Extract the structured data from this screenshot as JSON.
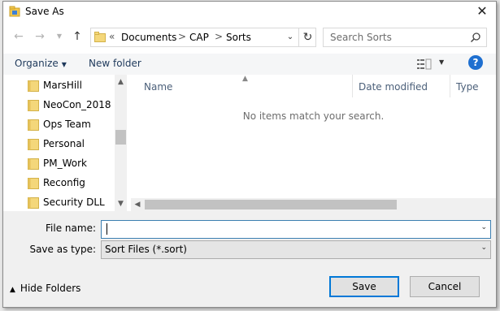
{
  "window": {
    "title": "Save As"
  },
  "address": {
    "overflow": "«",
    "crumbs": [
      "Documents",
      "CAP",
      "Sorts"
    ],
    "separator": ">"
  },
  "search": {
    "placeholder": "Search Sorts"
  },
  "toolbar": {
    "organize_label": "Organize",
    "new_folder_label": "New folder",
    "help_label": "?"
  },
  "navpane": {
    "items": [
      {
        "label": "MarsHill"
      },
      {
        "label": "NeoCon_2018"
      },
      {
        "label": "Ops Team"
      },
      {
        "label": "Personal"
      },
      {
        "label": "PM_Work"
      },
      {
        "label": "Reconfig"
      },
      {
        "label": "Security DLL"
      }
    ]
  },
  "filelist": {
    "columns": [
      "Name",
      "Date modified",
      "Type"
    ],
    "empty_message": "No items match your search."
  },
  "form": {
    "filename_label": "File name:",
    "filename_value": "",
    "savetype_label": "Save as type:",
    "savetype_value": "Sort Files (*.sort)"
  },
  "footer": {
    "hide_folders_label": "Hide Folders",
    "save_label": "Save",
    "cancel_label": "Cancel"
  },
  "colors": {
    "accent": "#0078d7",
    "folder": "#f4d77a",
    "link_text": "#1e395b"
  },
  "icons": {
    "app": "save-as-app-icon",
    "back": "back-arrow-icon",
    "forward": "forward-arrow-icon",
    "recent": "recent-locations-icon",
    "up": "up-arrow-icon",
    "refresh": "refresh-icon",
    "search": "search-icon",
    "view": "view-options-icon",
    "help": "help-icon",
    "close": "close-icon"
  }
}
